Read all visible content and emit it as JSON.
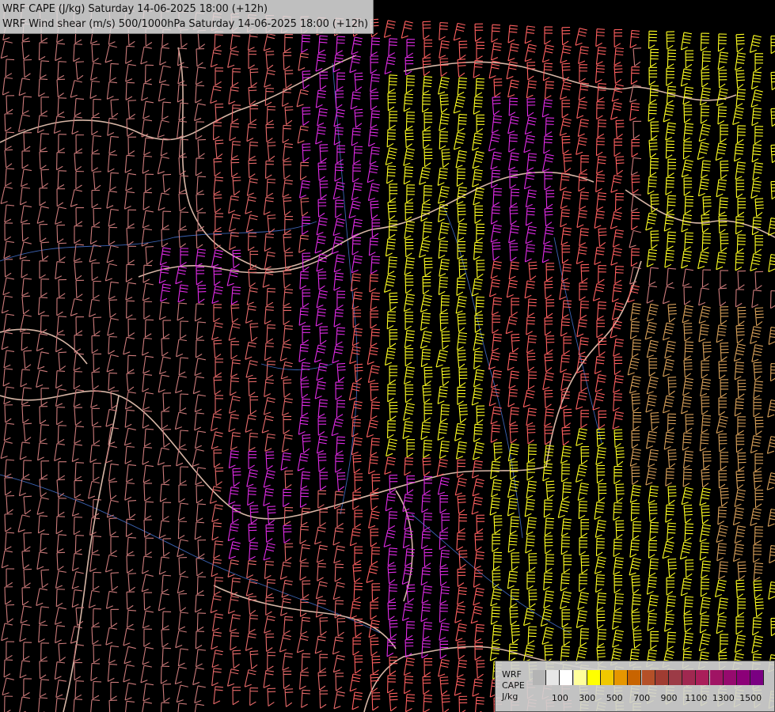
{
  "header": {
    "line1": "WRF CAPE (J/kg) Saturday 14-06-2025 18:00 (+12h)",
    "line2": "WRF Wind shear (m/s) 500/1000hPa Saturday 14-06-2025 18:00 (+12h)"
  },
  "legend": {
    "model": "WRF",
    "variable": "CAPE",
    "unit": "J/kg",
    "colors": [
      "#b4b4b4",
      "#e6e6e6",
      "#ffffff",
      "#ffff9c",
      "#ffff00",
      "#f0c800",
      "#e69600",
      "#c86400",
      "#b45028",
      "#a03c32",
      "#9c3b46",
      "#a02850",
      "#aa1e5a",
      "#a01464",
      "#960a6e",
      "#8c0078",
      "#7a0082"
    ],
    "tick_labels": [
      "100",
      "300",
      "500",
      "700",
      "900",
      "1100",
      "1300",
      "1500"
    ]
  },
  "map": {
    "barb_colors": {
      "weak": "#cc7a7a",
      "moderate": "#e86a6a",
      "strong": "#ff6060",
      "magenta": "#e12be6",
      "yellow": "#ffff22",
      "tan": "#d9a15a"
    },
    "border_color": "#d7b6a6",
    "river_color": "#3c63b4"
  }
}
